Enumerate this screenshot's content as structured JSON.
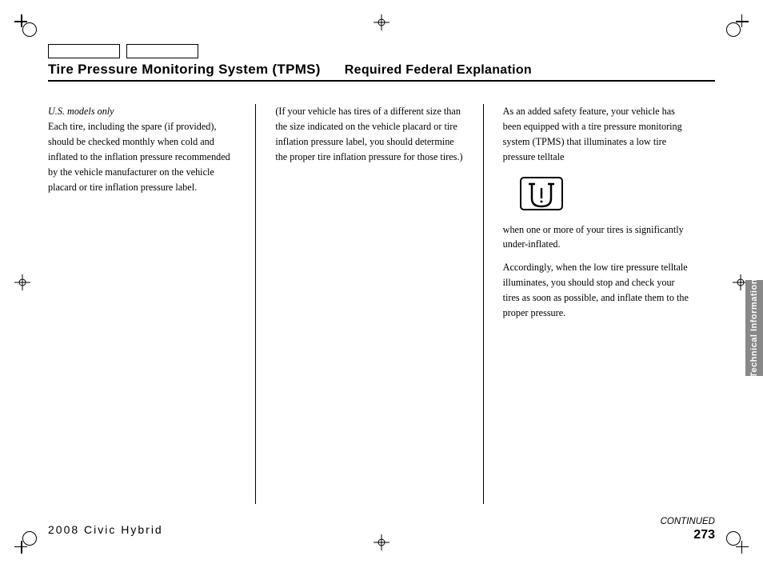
{
  "header": {
    "title_main": "Tire Pressure Monitoring System (TPMS)",
    "title_secondary": "Required Federal Explanation"
  },
  "columns": {
    "col1": {
      "italic_note": "U.S. models only",
      "body": "Each tire, including the spare (if provided), should be checked monthly when cold and inflated to the inflation pressure recommended by the vehicle manufacturer on the vehicle placard or tire inflation pressure label."
    },
    "col2": {
      "body": "(If your vehicle has tires of a different size than the size indicated on the vehicle placard or tire inflation pressure label, you should determine the proper tire inflation pressure for those tires.)"
    },
    "col3": {
      "para1": "As an added safety feature, your vehicle has been equipped with a tire pressure monitoring system (TPMS) that illuminates a low tire pressure telltale",
      "para2": "when one or more of your tires is significantly under-inflated.",
      "para3": "Accordingly, when the low tire pressure telltale illuminates, you should stop and check your tires as soon as possible, and inflate them to the proper pressure."
    }
  },
  "side_tab": {
    "label": "Technical Information"
  },
  "footer": {
    "model": "2008  Civic  Hybrid",
    "page": "273",
    "continued": "CONTINUED"
  }
}
